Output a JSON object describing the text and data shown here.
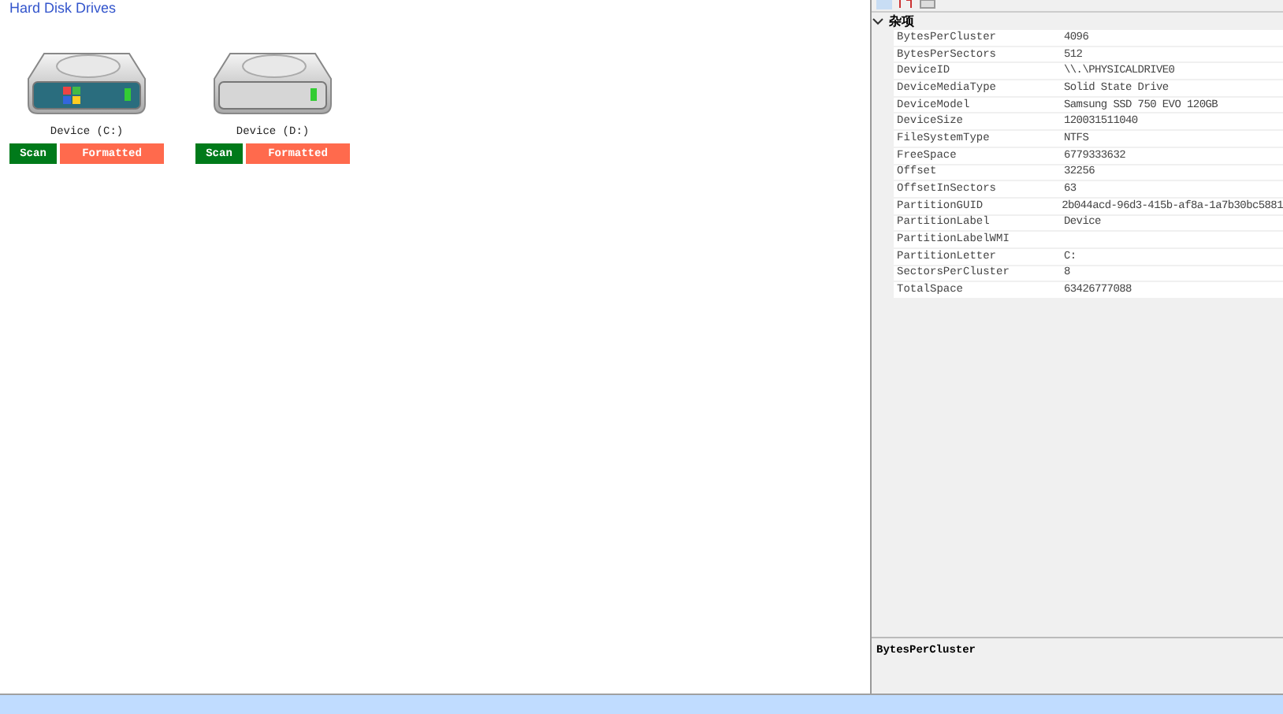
{
  "heading": "Hard Disk Drives",
  "drives": [
    {
      "label": "Device (C:)",
      "system": true,
      "scan": "Scan",
      "status": "Formatted"
    },
    {
      "label": "Device (D:)",
      "system": false,
      "scan": "Scan",
      "status": "Formatted"
    }
  ],
  "properties": {
    "category": "杂项",
    "expanded": true,
    "rows": [
      {
        "name": "BytesPerCluster",
        "value": "4096",
        "selected": false
      },
      {
        "name": "BytesPerSectors",
        "value": "512",
        "selected": false
      },
      {
        "name": "DeviceID",
        "value": "\\\\.\\PHYSICALDRIVE0",
        "selected": false
      },
      {
        "name": "DeviceMediaType",
        "value": "Solid State Drive",
        "selected": false
      },
      {
        "name": "DeviceModel",
        "value": "Samsung SSD 750 EVO 120GB",
        "selected": false
      },
      {
        "name": "DeviceSize",
        "value": "120031511040",
        "selected": false
      },
      {
        "name": "FileSystemType",
        "value": "NTFS",
        "selected": false
      },
      {
        "name": "FreeSpace",
        "value": "6779333632",
        "selected": false
      },
      {
        "name": "Offset",
        "value": "32256",
        "selected": false
      },
      {
        "name": "OffsetInSectors",
        "value": "63",
        "selected": false
      },
      {
        "name": "PartitionGUID",
        "value": "2b044acd-96d3-415b-af8a-1a7b30bc5881",
        "selected": false
      },
      {
        "name": "PartitionLabel",
        "value": "Device",
        "selected": false
      },
      {
        "name": "PartitionLabelWMI",
        "value": "",
        "selected": false
      },
      {
        "name": "PartitionLetter",
        "value": "C:",
        "selected": false
      },
      {
        "name": "SectorsPerCluster",
        "value": "8",
        "selected": false
      },
      {
        "name": "TotalSpace",
        "value": "63426777088",
        "selected": false
      }
    ],
    "description": "BytesPerCluster"
  }
}
